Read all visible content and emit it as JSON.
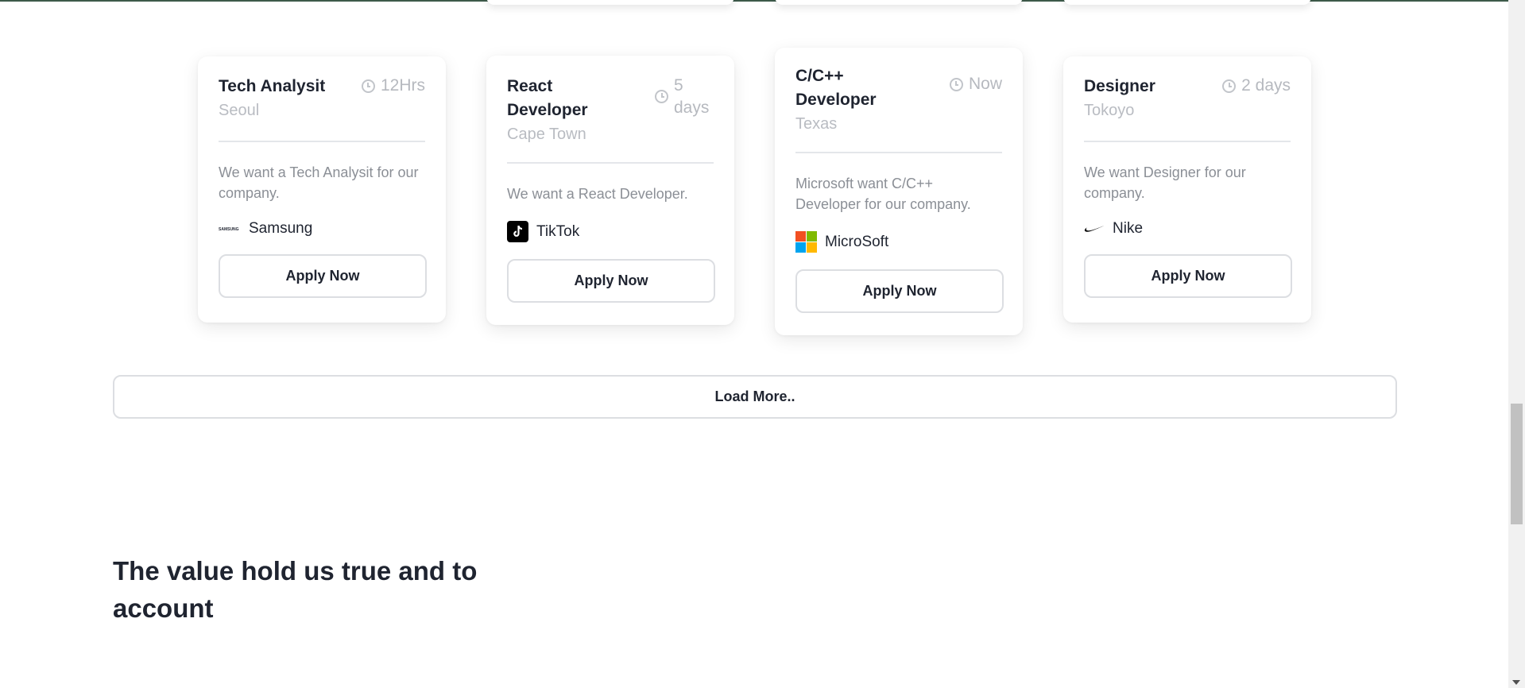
{
  "jobs": [
    {
      "title": "Tech Analysit",
      "location": "Seoul",
      "time": "12Hrs",
      "description": "We want a Tech Analysit for our company.",
      "company": "Samsung",
      "apply": "Apply Now"
    },
    {
      "title": "React Developer",
      "location": "Cape Town",
      "time": "5 days",
      "description": "We want a React Developer.",
      "company": "TikTok",
      "apply": "Apply Now"
    },
    {
      "title": "C/C++ Developer",
      "location": "Texas",
      "time": "Now",
      "description": "Microsoft want C/C++ Developer for our company.",
      "company": "MicroSoft",
      "apply": "Apply Now"
    },
    {
      "title": "Designer",
      "location": "Tokoyo",
      "time": "2 days",
      "description": "We want Designer for our company.",
      "company": "Nike",
      "apply": "Apply Now"
    }
  ],
  "samsung_logo_text": "SAMSUNG",
  "load_more_label": "Load More..",
  "section_title": "The value hold us true and to account",
  "colors": {
    "text": "#1f2430",
    "muted": "#b6b9bf",
    "description": "#8b8f96",
    "border": "#dcdee2",
    "microsoft_red": "#f25022",
    "microsoft_green": "#7fba00",
    "microsoft_blue": "#00a4ef",
    "microsoft_yellow": "#ffb900"
  },
  "icons": [
    "clock-icon",
    "samsung-logo",
    "tiktok-logo",
    "microsoft-logo",
    "nike-logo"
  ]
}
